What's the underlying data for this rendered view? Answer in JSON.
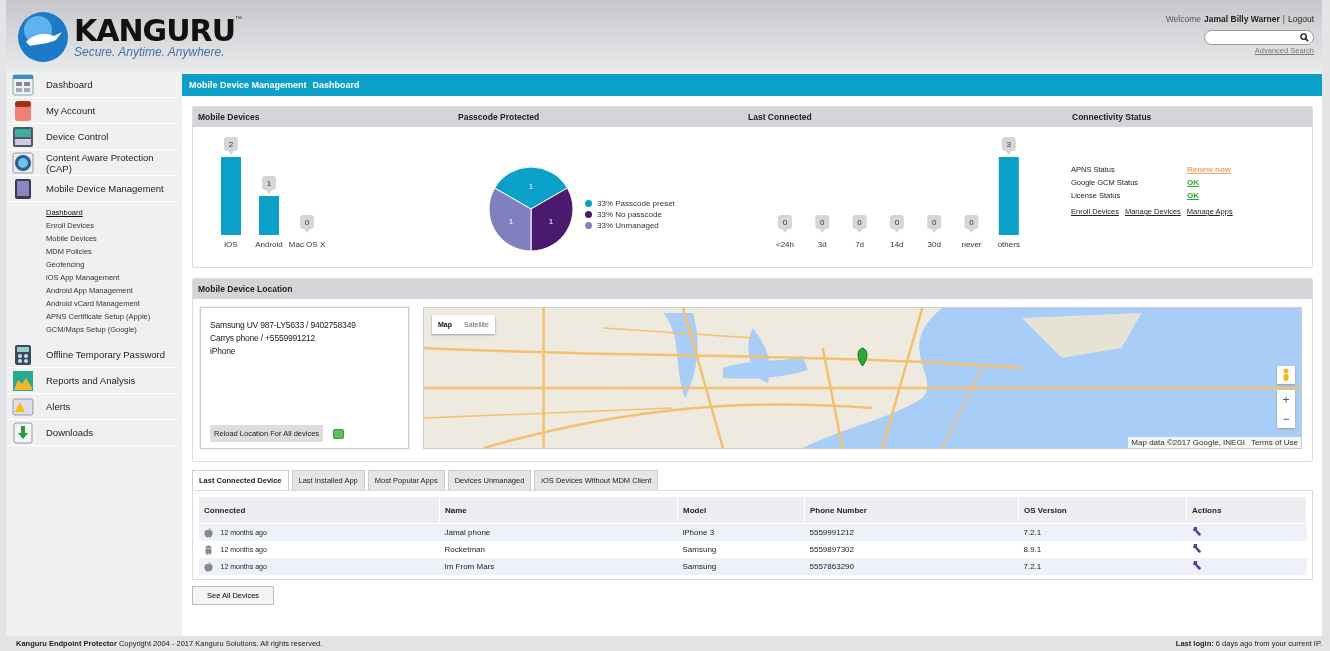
{
  "header": {
    "logo": {
      "name": "KANGURU",
      "trademark": "™",
      "tagline": "Secure. Anytime. Anywhere."
    },
    "welcome": {
      "prefix": "Welcome",
      "user": "Jamal Billy Warner",
      "separator": "|",
      "logout": "Logout"
    },
    "search": {
      "advanced_link": "Advanced Search"
    }
  },
  "sidebar": {
    "items": [
      {
        "label": "Dashboard"
      },
      {
        "label": "My Account"
      },
      {
        "label": "Device Control"
      },
      {
        "label": "Content Aware Protection (CAP)"
      },
      {
        "label": "Mobile Device Management",
        "children": [
          {
            "label": "Dashboard",
            "selected": true
          },
          {
            "label": "Enroll Devices",
            "selected": false
          },
          {
            "label": "Mobile Devices",
            "selected": false
          },
          {
            "label": "MDM Policies",
            "selected": false
          },
          {
            "label": "Geofencing",
            "selected": false
          },
          {
            "label": "iOS App Management",
            "selected": false
          },
          {
            "label": "Android App Management",
            "selected": false
          },
          {
            "label": "Android vCard Management",
            "selected": false
          },
          {
            "label": "APNS Certificate Setup (Apple)",
            "selected": false
          },
          {
            "label": "GCM/Maps Setup (Google)",
            "selected": false
          }
        ]
      },
      {
        "label": "Offline Temporary Password"
      },
      {
        "label": "Reports and Analysis"
      },
      {
        "label": "Alerts"
      },
      {
        "label": "Downloads"
      }
    ]
  },
  "breadcrumb": {
    "section": "Mobile Device Management",
    "page": "Dashboard"
  },
  "overview": {
    "mobile_devices": {
      "title": "Mobile Devices",
      "chart_data": {
        "type": "bar",
        "categories": [
          "iOS",
          "Android",
          "Mac OS X"
        ],
        "values": [
          2,
          1,
          0
        ],
        "data_labels": true
      }
    },
    "passcode_protected": {
      "title": "Passcode Protected",
      "chart_data": {
        "type": "pie",
        "categories": [
          "33% Passcode preset",
          "33% No passcode",
          "33% Unmanaged"
        ],
        "values": [
          1,
          1,
          1
        ],
        "data_labels": true
      },
      "legend": [
        {
          "color": "#0aa0c8"
        },
        {
          "color": "#4a1a6e"
        },
        {
          "color": "#7f80bd"
        }
      ]
    },
    "last_connected": {
      "title": "Last Connected",
      "chart_data": {
        "type": "bar",
        "categories": [
          "<24h",
          "3d",
          "7d",
          "14d",
          "30d",
          "never",
          "others"
        ],
        "values": [
          0,
          0,
          0,
          0,
          0,
          0,
          3
        ],
        "data_labels": true
      }
    },
    "connectivity_status": {
      "title": "Connectivity Status",
      "rows": [
        {
          "label": "APNS Status",
          "value": "Renew now",
          "color": "#f7a35c"
        },
        {
          "label": "Google GCM Status",
          "value": "OK",
          "color": "#2aa82a"
        },
        {
          "label": "License Status",
          "value": "OK",
          "color": "#2aa82a"
        }
      ],
      "links": [
        "Enroll Devices",
        "Manage Devices",
        "Manage Apps"
      ]
    }
  },
  "location": {
    "title": "Mobile Device Location",
    "devices": [
      "Samsung UV 987-LY5633 / 9402758349",
      "Carrys phone / +5559991212",
      "iPhone"
    ],
    "reload_button": "Reload Location For All devices",
    "online": true,
    "map": {
      "kind": "picture",
      "map_types": [
        {
          "label": "Map",
          "selected": true
        },
        {
          "label": "Satellite",
          "selected": false
        }
      ],
      "zoom_in": "+",
      "zoom_out": "−",
      "attribution": "Map data ©2017 Google, INEGI",
      "terms": "Terms of Use"
    }
  },
  "tabs": [
    {
      "label": "Last Connected Device",
      "selected": true
    },
    {
      "label": "Last Installed App",
      "selected": false
    },
    {
      "label": "Most Popular Apps",
      "selected": false
    },
    {
      "label": "Devices Unmanaged",
      "selected": false
    },
    {
      "label": "iOS Devices Without MDM Client",
      "selected": false
    }
  ],
  "table": {
    "columns": [
      "Connected",
      "Name",
      "Model",
      "Phone Number",
      "OS Version",
      "Actions"
    ],
    "rows": [
      {
        "kind": "apple",
        "connected": "12 months ago",
        "name": "Jamal phone",
        "model": "iPhone 3",
        "phone": "5559991212",
        "os": "7.2.1"
      },
      {
        "kind": "android",
        "connected": "12 months ago",
        "name": "Rocketman",
        "model": "Samsung",
        "phone": "5559897302",
        "os": "8.9.1"
      },
      {
        "kind": "apple",
        "connected": "12 months ago",
        "name": "Im From Mars",
        "model": "Samsung",
        "phone": "5557863290",
        "os": "7.2.1"
      }
    ]
  },
  "see_all_button": "See All Devices",
  "footer": {
    "copyright": "**Kanguru Endpoint Protector** Copyright 2004 - 2017 Kanguru Solutions. All rights reserved.",
    "last_login": "**Last login:** 6 days ago from your current IP."
  }
}
